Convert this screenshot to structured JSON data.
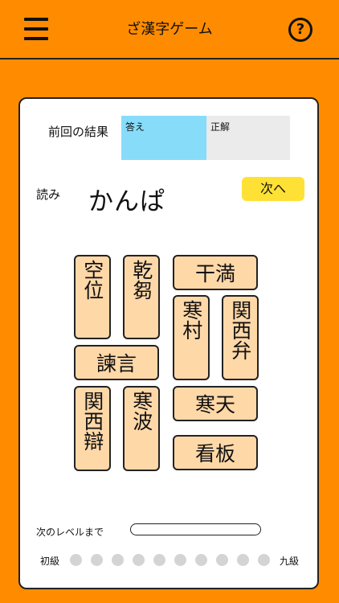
{
  "header": {
    "title": "ざ漢字ゲーム",
    "menu_icon": "hamburger-menu-icon",
    "help_icon": "question-circle-icon",
    "help_symbol": "?"
  },
  "result": {
    "label": "前回の結果",
    "answer_label": "答え",
    "correct_label": "正解",
    "answer_color": "#87DCFA",
    "correct_color": "#EBEBEB"
  },
  "question": {
    "reading_label": "読み",
    "reading": "かんぱ",
    "next_button": "次へ"
  },
  "tiles": {
    "t1": "空位",
    "t2": "乾芻",
    "t3": "干満",
    "t4": "寒村",
    "t5": "関西弁",
    "t6": "諫言",
    "t7": "関西辯",
    "t8": "寒波",
    "t9": "寒天",
    "t10": "看板"
  },
  "progress": {
    "label": "次のレベルまで",
    "value": 0
  },
  "levels": {
    "start": "初級",
    "end": "九級",
    "dot_count": 10,
    "filled": 0
  },
  "colors": {
    "background": "#FF8C00",
    "tile": "#FFD8A8",
    "next_button": "#FFE135"
  }
}
